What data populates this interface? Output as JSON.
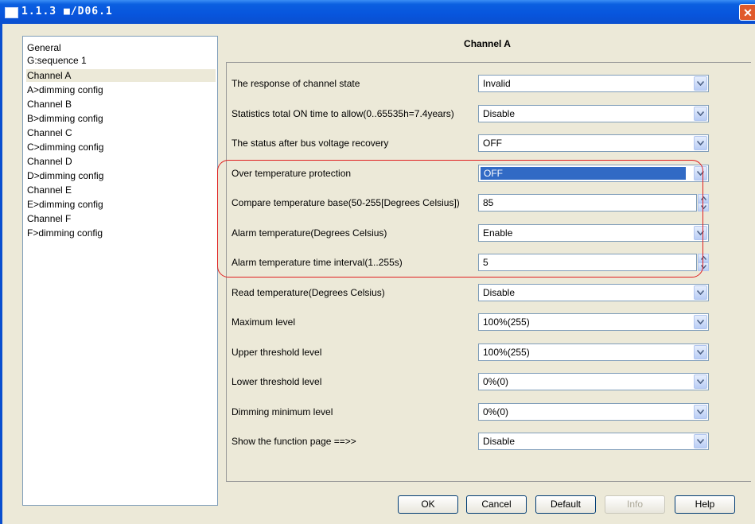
{
  "window": {
    "title": "1.1.3 ■/D06.1",
    "close_glyph": "✕"
  },
  "nav": {
    "items": [
      {
        "label": "General"
      },
      {
        "label": "G:sequence 1"
      },
      {
        "label": "Channel A",
        "selected": true
      },
      {
        "label": "A>dimming config"
      },
      {
        "label": "Channel B"
      },
      {
        "label": "B>dimming config"
      },
      {
        "label": "Channel C"
      },
      {
        "label": "C>dimming config"
      },
      {
        "label": "Channel D"
      },
      {
        "label": "D>dimming config"
      },
      {
        "label": "Channel E"
      },
      {
        "label": "E>dimming config"
      },
      {
        "label": "Channel F"
      },
      {
        "label": "F>dimming config"
      }
    ]
  },
  "main": {
    "title": "Channel A",
    "params": [
      {
        "label": "The response of channel state",
        "value": "Invalid",
        "type": "combo"
      },
      {
        "label": "Statistics total ON time to allow(0..65535h=7.4years)",
        "value": "Disable",
        "type": "combo"
      },
      {
        "label": "The status after bus voltage recovery",
        "value": "OFF",
        "type": "combo"
      },
      {
        "label": "Over temperature protection",
        "value": "OFF",
        "type": "combo",
        "focused": true
      },
      {
        "label": "Compare temperature base(50-255[Degrees Celsius])",
        "value": "85",
        "type": "spin"
      },
      {
        "label": "Alarm temperature(Degrees Celsius)",
        "value": "Enable",
        "type": "combo"
      },
      {
        "label": "Alarm temperature time interval(1..255s)",
        "value": "5",
        "type": "spin"
      },
      {
        "label": "Read temperature(Degrees Celsius)",
        "value": "Disable",
        "type": "combo"
      },
      {
        "label": "Maximum level",
        "value": "100%(255)",
        "type": "combo"
      },
      {
        "label": "Upper threshold level",
        "value": "100%(255)",
        "type": "combo"
      },
      {
        "label": "Lower threshold level",
        "value": "0%(0)",
        "type": "combo"
      },
      {
        "label": "Dimming minimum level",
        "value": "0%(0)",
        "type": "combo"
      },
      {
        "label": "Show the function page ==>>",
        "value": "Disable",
        "type": "combo"
      }
    ]
  },
  "buttons": {
    "ok": "OK",
    "cancel": "Cancel",
    "default": "Default",
    "info": "Info",
    "help": "Help"
  },
  "colors": {
    "highlight_ring": "#e02020",
    "selection": "#316ac5",
    "titlebar": "#0855dd"
  }
}
